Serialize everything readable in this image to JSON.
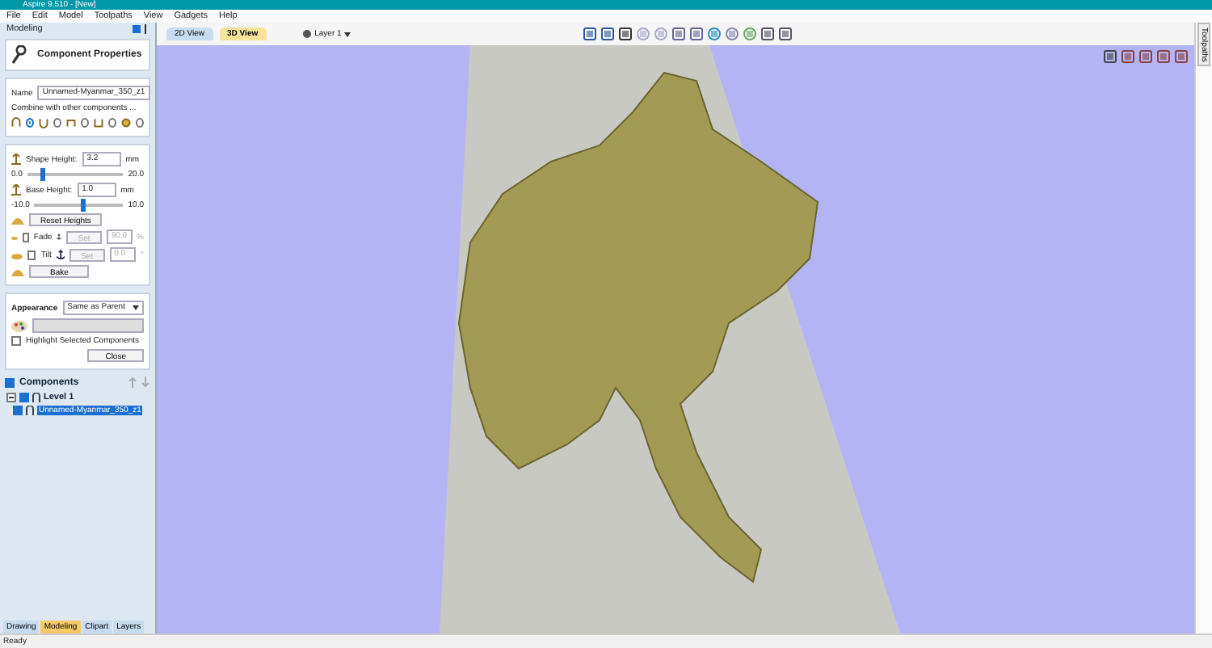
{
  "window": {
    "title": "Aspire 9.510 - [New]"
  },
  "menu": [
    "File",
    "Edit",
    "Model",
    "Toolpaths",
    "View",
    "Gadgets",
    "Help"
  ],
  "panel": {
    "title": "Modeling",
    "heading": "Component Properties",
    "name_label": "Name",
    "name_value": "Unnamed-Myanmar_350_z1",
    "combine_label": "Combine with other components ...",
    "combine_modes": [
      {
        "kind": "add",
        "selected": true
      },
      {
        "kind": "subtract",
        "selected": false
      },
      {
        "kind": "merge-high",
        "selected": false
      },
      {
        "kind": "merge-low",
        "selected": false
      },
      {
        "kind": "multiply",
        "selected": false
      }
    ],
    "shape_height": {
      "label": "Shape Height:",
      "value": "3.2",
      "unit": "mm",
      "min": "0.0",
      "max": "20.0",
      "level": 0.16
    },
    "base_height": {
      "label": "Base Height:",
      "value": "1.0",
      "unit": "mm",
      "min": "-10.0",
      "max": "10.0",
      "level": 0.55
    },
    "reset_button": "Reset Heights",
    "fade": {
      "label": "Fade",
      "checked": false,
      "set": "Set",
      "value": "90.0",
      "unit": "%",
      "disabled": true
    },
    "tilt": {
      "label": "Tilt",
      "checked": false,
      "set": "Set",
      "value": "0.0",
      "unit": "°",
      "disabled": true
    },
    "bake_button": "Bake",
    "appearance": {
      "label": "Appearance",
      "value": "Same as Parent"
    },
    "highlight": {
      "label": "Highlight Selected Components",
      "checked": false
    },
    "close_button": "Close"
  },
  "components": {
    "title": "Components",
    "checked": true,
    "tree": [
      {
        "label": "Level 1",
        "checked": true,
        "expanded": true,
        "selected": false,
        "children": [
          {
            "label": "Unnamed-Myanmar_350_z1",
            "checked": true,
            "selected": true
          }
        ]
      }
    ]
  },
  "bottom_tabs": [
    {
      "label": "Drawing",
      "selected": false
    },
    {
      "label": "Modeling",
      "selected": true
    },
    {
      "label": "Clipart",
      "selected": false
    },
    {
      "label": "Layers",
      "selected": false
    }
  ],
  "view_tabs": [
    {
      "label": "2D View",
      "selected": false
    },
    {
      "label": "3D View",
      "selected": true
    }
  ],
  "layer": "Layer 1",
  "side_tab": "Toolpaths",
  "status_bar": "Ready"
}
